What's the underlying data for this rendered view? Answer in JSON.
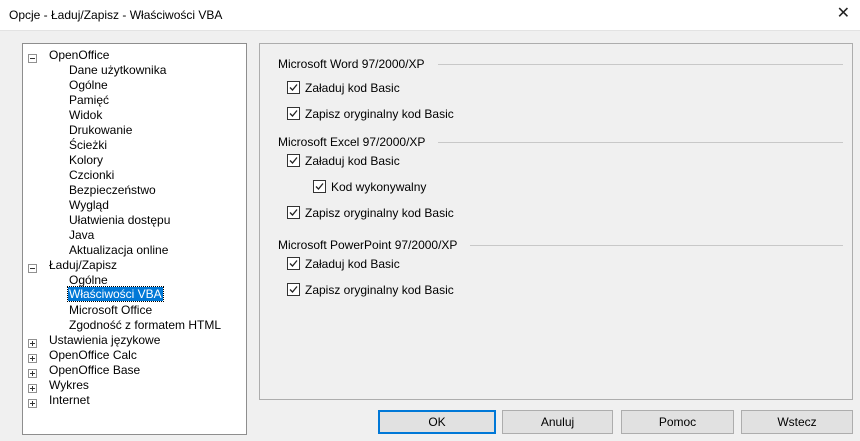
{
  "window": {
    "title": "Opcje - Ładuj/Zapisz - Właściwości VBA",
    "close_glyph": "✕"
  },
  "tree": {
    "openoffice": {
      "label": "OpenOffice",
      "children": [
        "Dane użytkownika",
        "Ogólne",
        "Pamięć",
        "Widok",
        "Drukowanie",
        "Ścieżki",
        "Kolory",
        "Czcionki",
        "Bezpieczeństwo",
        "Wygląd",
        "Ułatwienia dostępu",
        "Java",
        "Aktualizacja online"
      ]
    },
    "laduj": {
      "label": "Ładuj/Zapisz",
      "children": [
        "Ogólne",
        "Właściwości VBA",
        "Microsoft Office",
        "Zgodność z formatem HTML"
      ],
      "selected_index": 1
    },
    "collapsed": [
      "Ustawienia językowe",
      "OpenOffice Calc",
      "OpenOffice Base",
      "Wykres",
      "Internet"
    ]
  },
  "sections": {
    "word": {
      "title": "Microsoft Word 97/2000/XP",
      "load": {
        "label": "Załaduj kod Basic",
        "checked": true
      },
      "save": {
        "label": "Zapisz oryginalny kod Basic",
        "checked": true
      }
    },
    "excel": {
      "title": "Microsoft Excel 97/2000/XP",
      "load": {
        "label": "Załaduj kod Basic",
        "checked": true
      },
      "exec": {
        "label": "Kod wykonywalny",
        "checked": true
      },
      "save": {
        "label": "Zapisz oryginalny kod Basic",
        "checked": true
      }
    },
    "powerpoint": {
      "title": "Microsoft PowerPoint 97/2000/XP",
      "load": {
        "label": "Załaduj kod Basic",
        "checked": true
      },
      "save": {
        "label": "Zapisz oryginalny kod Basic",
        "checked": true
      }
    }
  },
  "buttons": {
    "ok": "OK",
    "cancel": "Anuluj",
    "help": "Pomoc",
    "back": "Wstecz"
  },
  "colors": {
    "selection": "#0078d7",
    "default_button_border": "#0078d7"
  }
}
